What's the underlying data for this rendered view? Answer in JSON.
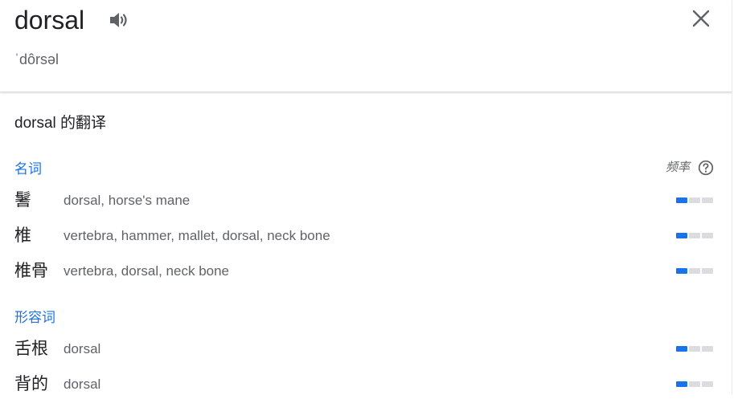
{
  "header": {
    "word": "dorsal",
    "phonetic": "ˈdôrsəl"
  },
  "section": {
    "title": "dorsal 的翻译"
  },
  "frequency_label": "频率",
  "colors": {
    "accent": "#1a73e8",
    "bar_off": "#dadce0"
  },
  "groups": [
    {
      "pos": "名词",
      "rows": [
        {
          "term": "鬐",
          "synonyms": "dorsal, horse's mane",
          "frequency": 1
        },
        {
          "term": "椎",
          "synonyms": "vertebra, hammer, mallet, dorsal, neck bone",
          "frequency": 1
        },
        {
          "term": "椎骨",
          "synonyms": "vertebra, dorsal, neck bone",
          "frequency": 1
        }
      ]
    },
    {
      "pos": "形容词",
      "rows": [
        {
          "term": "舌根",
          "synonyms": "dorsal",
          "frequency": 1
        },
        {
          "term": "背的",
          "synonyms": "dorsal",
          "frequency": 1
        }
      ]
    }
  ]
}
